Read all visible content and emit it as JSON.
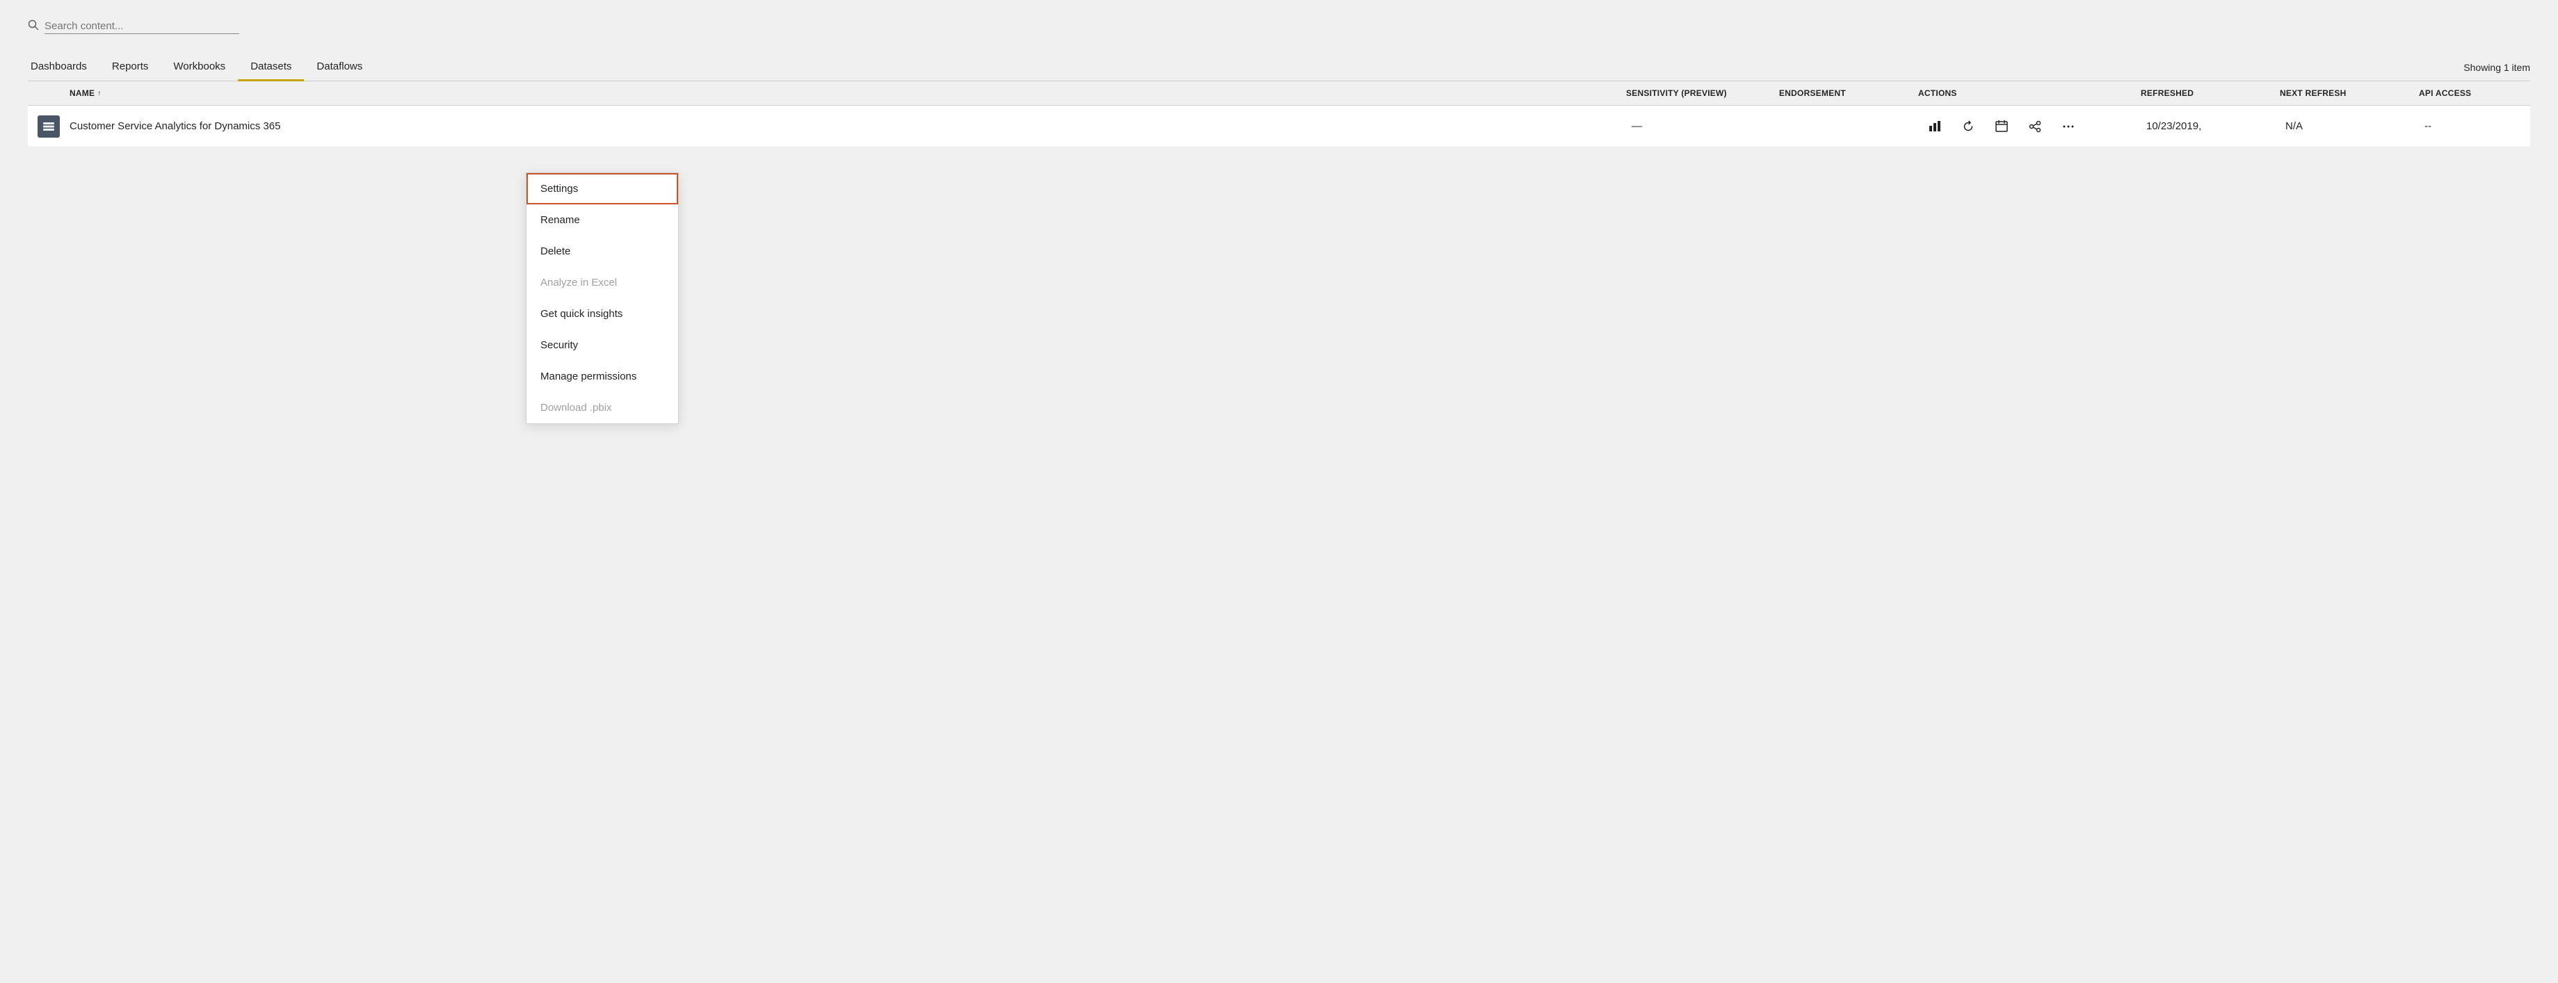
{
  "search": {
    "placeholder": "Search content..."
  },
  "showing": {
    "text": "Showing 1 item"
  },
  "nav": {
    "tabs": [
      {
        "id": "dashboards",
        "label": "Dashboards",
        "active": false
      },
      {
        "id": "reports",
        "label": "Reports",
        "active": false
      },
      {
        "id": "workbooks",
        "label": "Workbooks",
        "active": false
      },
      {
        "id": "datasets",
        "label": "Datasets",
        "active": true
      },
      {
        "id": "dataflows",
        "label": "Dataflows",
        "active": false
      }
    ]
  },
  "table": {
    "columns": [
      {
        "id": "name",
        "label": "NAME",
        "sortable": true,
        "sort": "asc"
      },
      {
        "id": "sensitivity",
        "label": "SENSITIVITY (preview)",
        "sortable": false
      },
      {
        "id": "endorsement",
        "label": "ENDORSEMENT",
        "sortable": false
      },
      {
        "id": "actions",
        "label": "ACTIONS",
        "sortable": false
      },
      {
        "id": "refreshed",
        "label": "REFRESHED",
        "sortable": false
      },
      {
        "id": "next_refresh",
        "label": "NEXT REFRESH",
        "sortable": false
      },
      {
        "id": "api_access",
        "label": "API ACCESS",
        "sortable": false
      }
    ],
    "rows": [
      {
        "id": "row1",
        "name": "Customer Service Analytics for Dynamics 365",
        "sensitivity": "—",
        "endorsement": "",
        "refreshed": "10/23/2019,",
        "next_refresh": "N/A",
        "api_access": "--"
      }
    ]
  },
  "dropdown": {
    "items": [
      {
        "id": "settings",
        "label": "Settings",
        "highlighted": true,
        "disabled": false
      },
      {
        "id": "rename",
        "label": "Rename",
        "highlighted": false,
        "disabled": false
      },
      {
        "id": "delete",
        "label": "Delete",
        "highlighted": false,
        "disabled": false
      },
      {
        "id": "analyze-excel",
        "label": "Analyze in Excel",
        "highlighted": false,
        "disabled": true
      },
      {
        "id": "quick-insights",
        "label": "Get quick insights",
        "highlighted": false,
        "disabled": false
      },
      {
        "id": "security",
        "label": "Security",
        "highlighted": false,
        "disabled": false
      },
      {
        "id": "manage-permissions",
        "label": "Manage permissions",
        "highlighted": false,
        "disabled": false
      },
      {
        "id": "download-pbix",
        "label": "Download .pbix",
        "highlighted": false,
        "disabled": true
      }
    ]
  }
}
